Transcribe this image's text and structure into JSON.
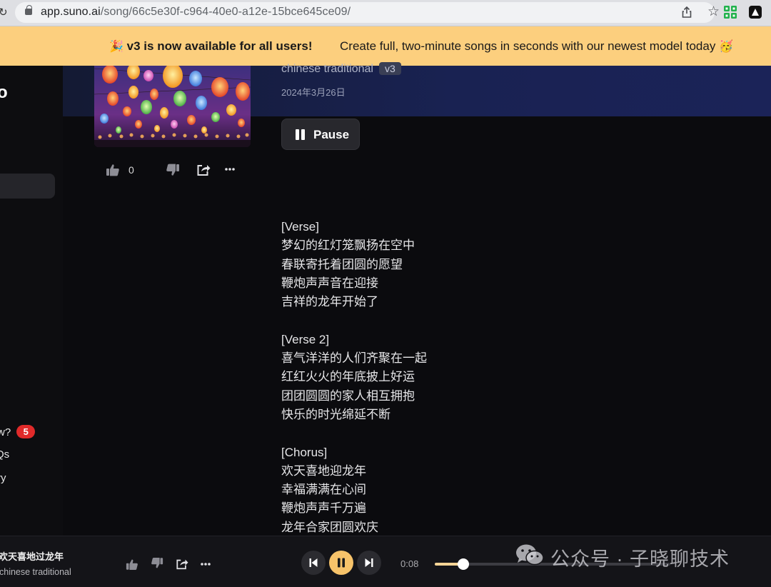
{
  "browser": {
    "url_host": "app.suno.ai",
    "url_path": "/song/66c5e30f-c964-40e0-a12e-15bce645ce09/"
  },
  "banner": {
    "headline": "v3 is now available for all users!",
    "message": "Create full, two-minute songs in seconds with our newest model today",
    "emoji_left": "🎉",
    "emoji_right": "🥳",
    "background": "#fccf7e"
  },
  "sidebar": {
    "logo_fragment": "o",
    "links": [
      {
        "label": "w?",
        "badge": "5"
      },
      {
        "label": "Qs"
      },
      {
        "label": "ry"
      }
    ]
  },
  "song": {
    "style": "chinese traditional",
    "version": "v3",
    "date": "2024年3月26日",
    "likes": "0",
    "pause_label": "Pause"
  },
  "lyrics": [
    "[Verse]",
    "梦幻的红灯笼飘扬在空中",
    "春联寄托着团圆的愿望",
    "鞭炮声声音在迎接",
    "吉祥的龙年开始了",
    "",
    "[Verse 2]",
    "喜气洋洋的人们齐聚在一起",
    "红红火火的年底披上好运",
    "团团圆圆的家人相互拥抱",
    "快乐的时光绵延不断",
    "",
    "[Chorus]",
    "欢天喜地迎龙年",
    "幸福满满在心间",
    "鞭炮声声千万遍",
    "龙年合家团圆欢庆"
  ],
  "player": {
    "title": "欢天喜地过龙年",
    "style": "chinese traditional",
    "elapsed": "0:08",
    "progress": 0.12,
    "accent": "#f7c36a"
  },
  "watermark": {
    "text": "公众号 · 子晓聊技术"
  }
}
